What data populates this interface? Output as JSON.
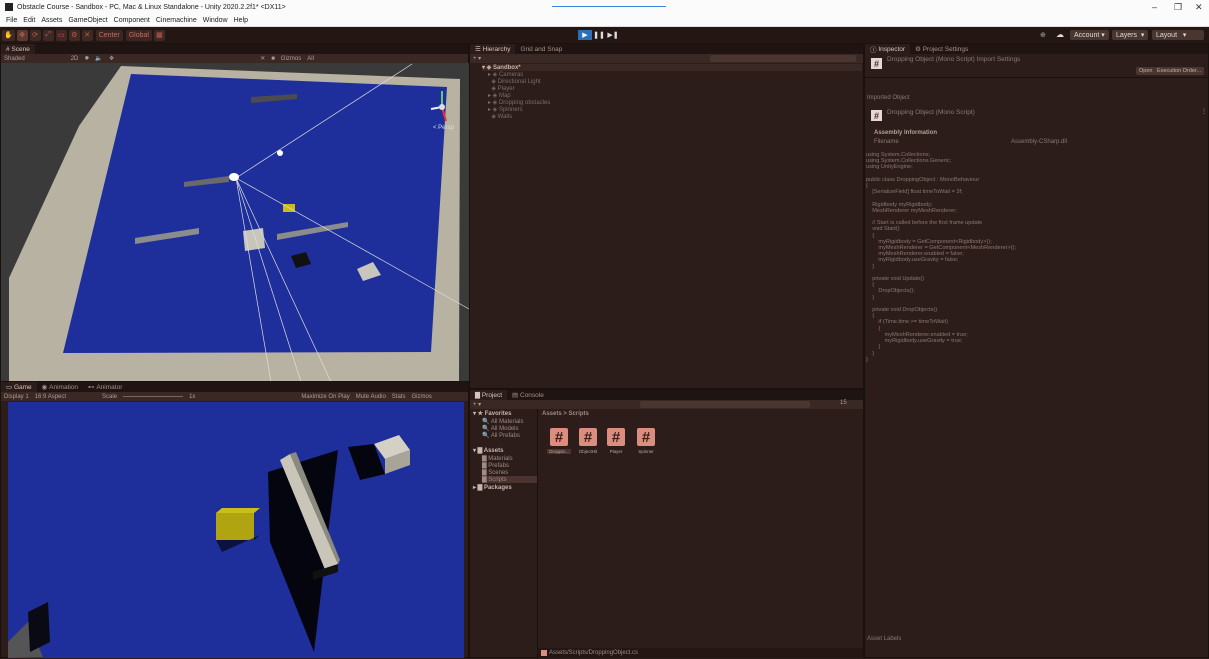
{
  "window": {
    "title": "Obstacle Course - Sandbox - PC, Mac & Linux Standalone - Unity 2020.2.2f1* <DX11>",
    "min": "–",
    "max": "❐",
    "close": "✕"
  },
  "menu": [
    "File",
    "Edit",
    "Assets",
    "GameObject",
    "Component",
    "Cinemachine",
    "Window",
    "Help"
  ],
  "toolbar": {
    "tools": [
      "✋",
      "✥",
      "⟳",
      "⤢",
      "▭",
      "⚙",
      "✕"
    ],
    "pivot": "Center",
    "space": "Global",
    "account": "Account",
    "layers": "Layers",
    "layout": "Layout",
    "play_icons": [
      "▶",
      "❚❚",
      "▶❚"
    ]
  },
  "scene": {
    "tab": "Scene",
    "shading": "Shaded",
    "mode_2d": "2D",
    "gizmos": "Gizmos",
    "search_hint": "All",
    "persp": "< Persp",
    "colors": {
      "floor": "#1e2f9c",
      "border": "#b8b2a3"
    }
  },
  "game": {
    "tabs": [
      "Game",
      "Animation",
      "Animator"
    ],
    "display": "Display 1",
    "aspect": "16:9 Aspect",
    "scale_label": "Scale",
    "scale_value": "1x",
    "options": [
      "Maximize On Play",
      "Mute Audio",
      "Stats",
      "Gizmos"
    ]
  },
  "hierarchy": {
    "tabs": [
      "Hierarchy",
      "Grid and Snap"
    ],
    "add": "+ ▾",
    "search_hint": "All",
    "root": "Sandbox*",
    "items": [
      "Cameras",
      "Directional Light",
      "Player",
      "Map",
      "Dropping obstacles",
      "Spinners",
      "Walls"
    ]
  },
  "project": {
    "tabs": [
      "Project",
      "Console"
    ],
    "favorites_header": "Favorites",
    "favorites": [
      "All Materials",
      "All Models",
      "All Prefabs"
    ],
    "assets_header": "Assets",
    "folders": [
      "Materials",
      "Prefabs",
      "Scenes",
      "Scripts"
    ],
    "packages": "Packages",
    "breadcrumb": [
      "Assets",
      "Scripts"
    ],
    "files": [
      "Droppin...",
      "ObjectHit",
      "Player",
      "Spinner"
    ],
    "footer_path": "Assets/Scripts/DroppingObject.cs",
    "badge_count": "15"
  },
  "inspector": {
    "tabs": [
      "Inspector",
      "Project Settings"
    ],
    "header": "Dropping Object (Mono Script) Import Settings",
    "open_btn": "Open",
    "exec_btn": "Execution Order...",
    "imported_label": "Imported Object",
    "imported_name": "Dropping Object (Mono Script)",
    "assembly_header": "Assembly Information",
    "filename_label": "Filename",
    "filename_value": "Assembly-CSharp.dll",
    "code": "using System.Collections;\nusing System.Collections.Generic;\nusing UnityEngine;\n\npublic class DroppingObject : MonoBehaviour\n{\n    [SerializeField] float timeToWait = 3f;\n\n    Rigidbody myRigidbody;\n    MeshRenderer myMeshRenderer;\n\n    // Start is called before the first frame update\n    void Start()\n    {\n        myRigidbody = GetComponent<Rigidbody>();\n        myMeshRenderer = GetComponent<MeshRenderer>();\n        myMeshRenderer.enabled = false;\n        myRigidbody.useGravity = false;\n    }\n\n    private void Update()\n    {\n        DropObjects();\n    }\n\n    private void DropObjects()\n    {\n        if (Time.time >= timeToWait)\n        {\n            myMeshRenderer.enabled = true;\n            myRigidbody.useGravity = true;\n        }\n    }\n}",
    "asset_labels": "Asset Labels"
  }
}
